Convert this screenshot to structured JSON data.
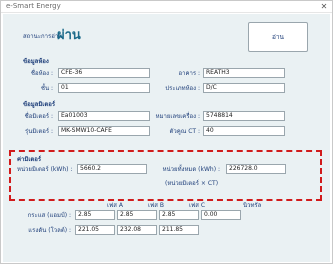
{
  "window": {
    "title": "e-Smart Energy",
    "close_glyph": "✕"
  },
  "status": {
    "label": "สถานะการอ่าน",
    "value": "ผ่าน"
  },
  "read_button_label": "อ่าน",
  "room_section": {
    "title": "ข้อมูลห้อง",
    "room_name_label": "ชื่อห้อง :",
    "room_name_value": "CFE-36",
    "building_label": "อาคาร :",
    "building_value": "REATH3",
    "floor_label": "ชั้น :",
    "floor_value": "01",
    "room_type_label": "ประเภทห้อง :",
    "room_type_value": "D/C"
  },
  "meter_section": {
    "title": "ข้อมูลมิเตอร์",
    "meter_id_label": "ชื่อมิเตอร์ :",
    "meter_id_value": "Ea01003",
    "serial_label": "หมายเลขเครื่อง :",
    "serial_value": "5748814",
    "model_label": "รุ่นมิเตอร์ :",
    "model_value": "MK-SMW10-CAFE",
    "ct_label": "ตัวคูณ CT :",
    "ct_value": "40"
  },
  "reading_section": {
    "title": "ค่ามิเตอร์",
    "meter_unit_label": "หน่วยมิเตอร์ (kWh) :",
    "meter_unit_value": "5660.2",
    "total_unit_label": "หน่วยทั้งหมด (kWh) :",
    "total_unit_value": "226728.0",
    "total_unit_note": "(หน่วยมิเตอร์ × CT)"
  },
  "phase_table": {
    "headers": [
      "เฟส A",
      "เฟส B",
      "เฟส C",
      "นิวทรัล"
    ],
    "current_label": "กระแส (แอมป์) :",
    "current_values": [
      "2.85",
      "2.85",
      "2.85",
      "0.00"
    ],
    "voltage_label": "แรงดัน (โวลต์) :",
    "voltage_values": [
      "221.05",
      "232.08",
      "211.85"
    ]
  }
}
